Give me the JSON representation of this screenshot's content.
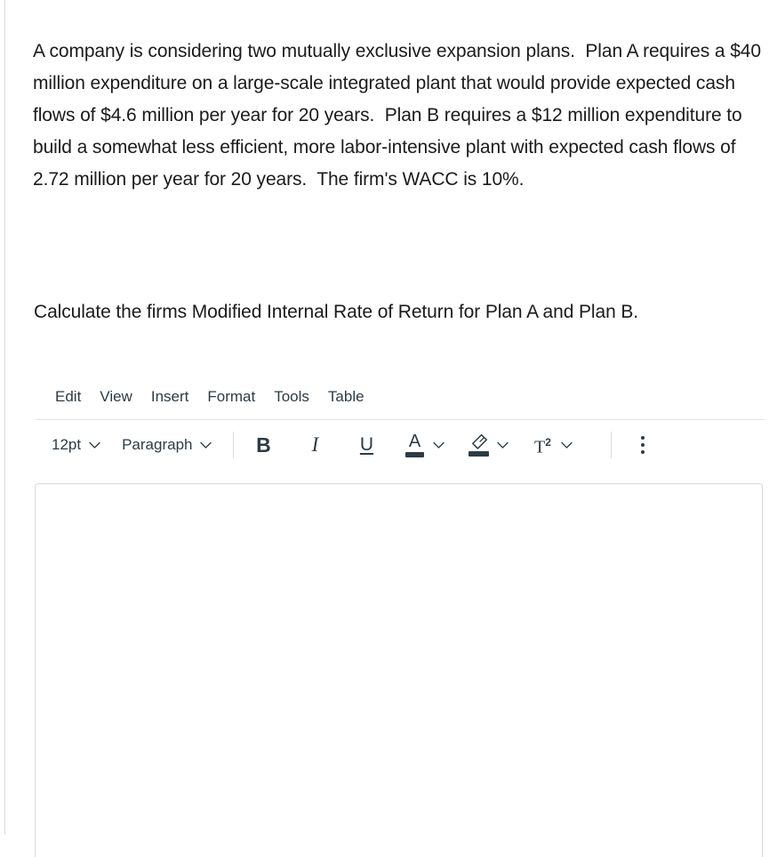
{
  "question": {
    "body": "A company is considering two mutually exclusive expansion plans.  Plan A requires a $40 million expenditure on a large-scale integrated plant that would provide expected cash flows of $4.6 million per year for 20 years.  Plan B requires a $12 million expenditure to build a somewhat less efficient, more labor-intensive plant with expected cash flows of 2.72 million per year for 20 years.  The firm's WACC is 10%.",
    "prompt": "Calculate the firms Modified Internal Rate of Return for Plan A and Plan B."
  },
  "editor": {
    "menubar": [
      {
        "label": "Edit",
        "name": "menu-item-edit"
      },
      {
        "label": "View",
        "name": "menu-item-view"
      },
      {
        "label": "Insert",
        "name": "menu-item-insert"
      },
      {
        "label": "Format",
        "name": "menu-item-format"
      },
      {
        "label": "Tools",
        "name": "menu-item-tools"
      },
      {
        "label": "Table",
        "name": "menu-item-table"
      }
    ],
    "toolbar": {
      "font_size": "12pt",
      "block_format": "Paragraph",
      "bold": "B",
      "italic": "I",
      "underline": "U",
      "text_color": "A",
      "superscript": "T",
      "superscript_exponent": "2",
      "chevron": "∨"
    },
    "content": "",
    "placeholder": ""
  },
  "colors": {
    "text": "#1b1b1b",
    "ui_text": "#2d3b45",
    "divider": "#e2e4e6",
    "border": "#d7dbde",
    "background": "#ffffff"
  }
}
